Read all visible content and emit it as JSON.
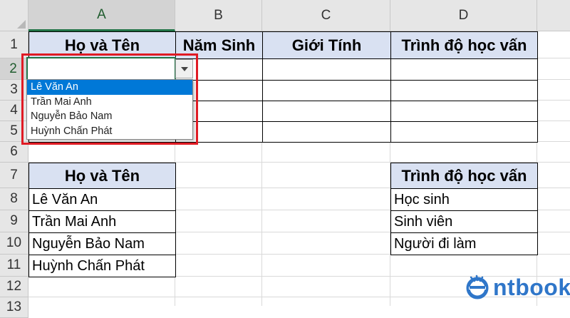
{
  "columns": [
    "A",
    "B",
    "C",
    "D"
  ],
  "rows": [
    "1",
    "2",
    "3",
    "4",
    "5",
    "6",
    "7",
    "8",
    "9",
    "10",
    "11",
    "12",
    "13"
  ],
  "sheet": {
    "header_row": [
      "Họ và Tên",
      "Năm Sinh",
      "Giới Tính",
      "Trình độ học vấn"
    ],
    "names_header": "Họ và Tên",
    "names": [
      "Lê Văn An",
      "Trần Mai Anh",
      "Nguyễn Bảo Nam",
      "Huỳnh Chấn Phát"
    ],
    "education_header": "Trình độ học vấn",
    "education": [
      "Học sinh",
      "Sinh viên",
      "Người đi làm"
    ]
  },
  "dropdown": {
    "current_value": "",
    "selected_index": 0,
    "options": [
      "Lê Văn An",
      "Trần Mai Anh",
      "Nguyễn Bảo Nam",
      "Huỳnh Chấn Phát"
    ]
  },
  "logo": {
    "text": "ntbook"
  },
  "colors": {
    "header_fill": "#d9e1f2",
    "selection_green": "#217346",
    "dropdown_highlight": "#0078d7",
    "annotation_red": "#e01b24",
    "logo_blue": "#2f76c9"
  }
}
